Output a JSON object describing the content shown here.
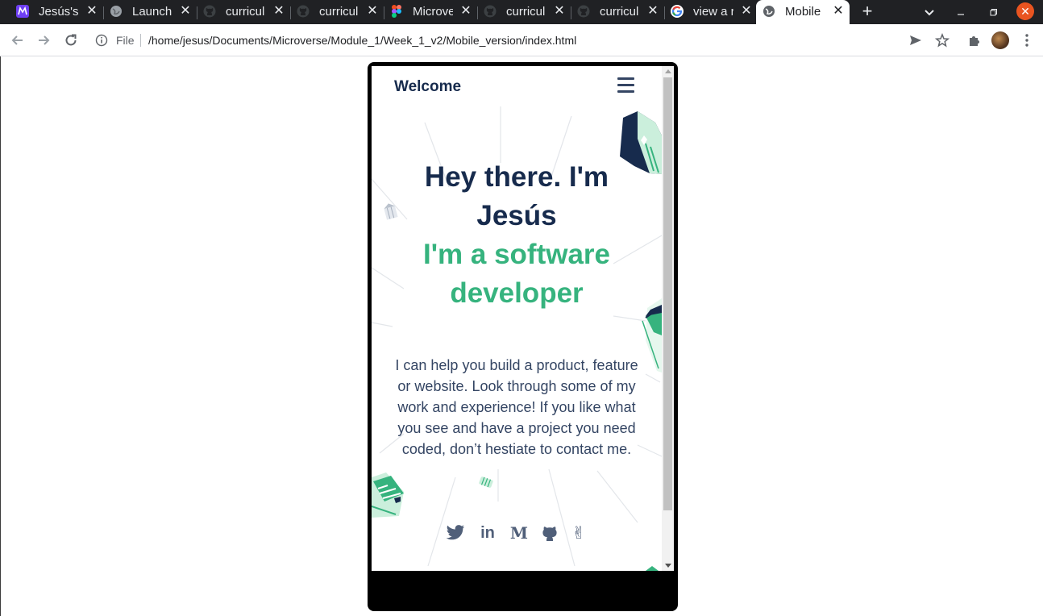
{
  "browser": {
    "tabs": [
      {
        "title": "Jesús's",
        "favicon": "microverse-icon"
      },
      {
        "title": "Launch",
        "favicon": "globe-icon"
      },
      {
        "title": "curricul",
        "favicon": "github-icon"
      },
      {
        "title": "curricul",
        "favicon": "github-icon"
      },
      {
        "title": "Microve",
        "favicon": "figma-icon"
      },
      {
        "title": "curricul",
        "favicon": "github-icon"
      },
      {
        "title": "curricul",
        "favicon": "github-icon"
      },
      {
        "title": "view a r",
        "favicon": "google-icon"
      },
      {
        "title": "Mobile",
        "favicon": "globe-icon",
        "active": true
      }
    ],
    "close_glyph": "✕",
    "new_tab_glyph": "+",
    "omnibox": {
      "scheme_label": "File",
      "url": "/home/jesus/Documents/Microverse/Module_1/Week_1_v2/Mobile_version/index.html"
    },
    "colors": {
      "tabstrip": "#202124",
      "window_close": "#e95420"
    }
  },
  "page": {
    "brand": "Welcome",
    "headline": "Hey there. I'm Jesús",
    "subheadline": "I'm a software developer",
    "bio": "I can help you build a product, feature or website. Look through some of my work and experience! If you like what you see and have a project you need coded, don’t hestiate to contact me.",
    "socials": [
      {
        "name": "twitter-icon",
        "glyph": ""
      },
      {
        "name": "linkedin-icon",
        "glyph": "in"
      },
      {
        "name": "medium-icon",
        "glyph": "M"
      },
      {
        "name": "github-icon",
        "glyph": ""
      },
      {
        "name": "angellist-icon",
        "glyph": "✌"
      }
    ],
    "colors": {
      "heading": "#172b4d",
      "accent": "#36b37e",
      "text": "#344563"
    }
  }
}
